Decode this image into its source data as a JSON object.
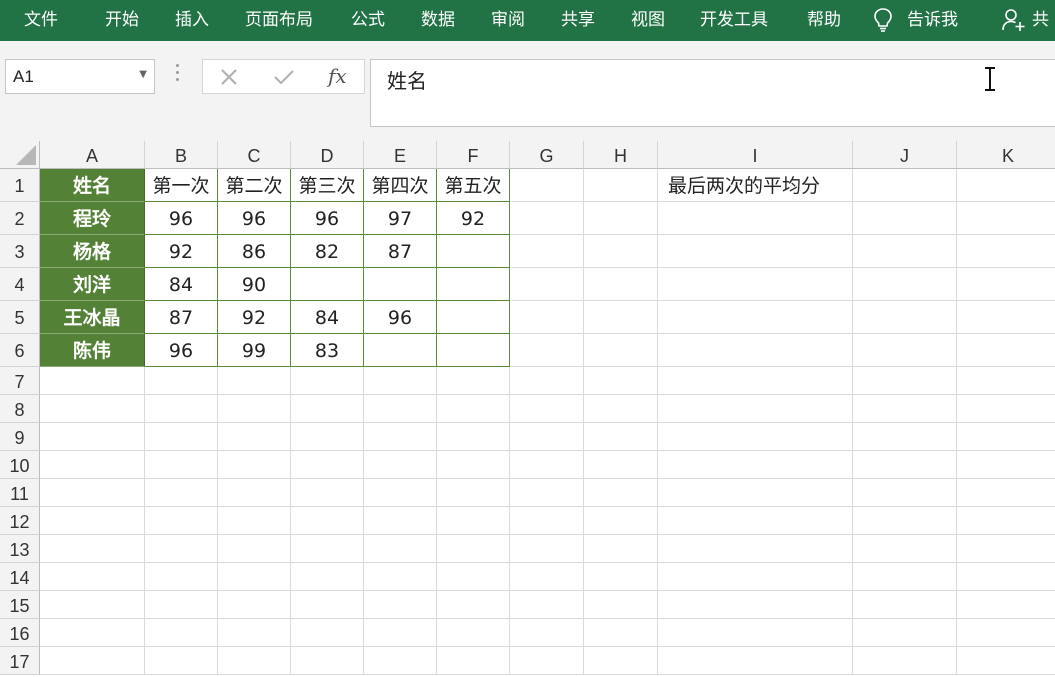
{
  "ribbon": {
    "tabs": [
      "文件",
      "开始",
      "插入",
      "页面布局",
      "公式",
      "数据",
      "审阅",
      "共享",
      "视图",
      "开发工具",
      "帮助"
    ],
    "tell_me": "告诉我",
    "share": "共"
  },
  "icons": {
    "tell_me": "lightbulb-icon",
    "share": "person-add-icon",
    "cancel": "x-icon",
    "enter": "check-icon",
    "function": "fx-icon",
    "cursor": "text-cursor-icon"
  },
  "colors": {
    "ribbon": "#217346",
    "name_fill": "#538135",
    "table_border": "#5a8c3a"
  },
  "name_box": {
    "value": "A1"
  },
  "formula_bar": {
    "fx_label": "fx",
    "value": "姓名"
  },
  "sheet": {
    "columns": [
      "A",
      "B",
      "C",
      "D",
      "E",
      "F",
      "G",
      "H",
      "I",
      "J",
      "K"
    ],
    "rows": [
      "1",
      "2",
      "3",
      "4",
      "5",
      "6",
      "7",
      "8",
      "9",
      "10",
      "11",
      "12",
      "13",
      "14",
      "15",
      "16",
      "17"
    ],
    "header": [
      "姓名",
      "第一次",
      "第二次",
      "第三次",
      "第四次",
      "第五次"
    ],
    "records": [
      [
        "程玲",
        "96",
        "96",
        "96",
        "97",
        "92"
      ],
      [
        "杨格",
        "92",
        "86",
        "82",
        "87",
        ""
      ],
      [
        "刘洋",
        "84",
        "90",
        "",
        "",
        ""
      ],
      [
        "王冰晶",
        "87",
        "92",
        "84",
        "96",
        ""
      ],
      [
        "陈伟",
        "96",
        "99",
        "83",
        "",
        ""
      ]
    ],
    "note": "最后两次的平均分"
  }
}
